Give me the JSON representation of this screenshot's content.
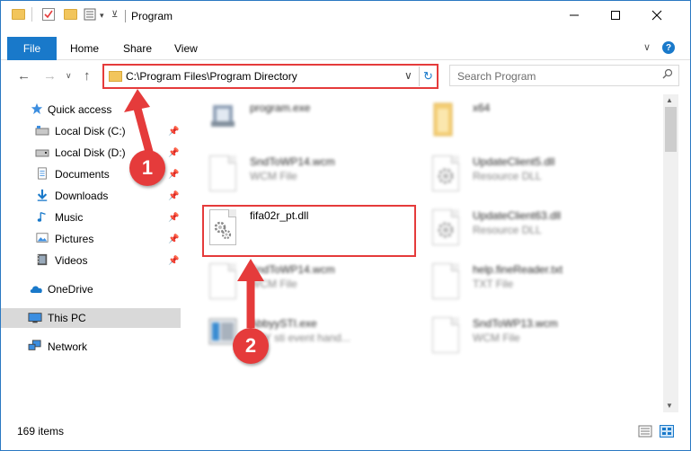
{
  "window": {
    "title": "Program",
    "minimize_icon": "minimize-icon",
    "maximize_icon": "maximize-icon",
    "close_icon": "close-icon"
  },
  "ribbon": {
    "tabs": [
      {
        "label": "File"
      },
      {
        "label": "Home"
      },
      {
        "label": "Share"
      },
      {
        "label": "View"
      }
    ],
    "help": "?"
  },
  "navigation": {
    "address": "C:\\Program Files\\Program Directory",
    "search_placeholder": "Search Program"
  },
  "sidebar": {
    "items": [
      {
        "label": "Quick access",
        "icon": "star-icon"
      },
      {
        "label": "Local Disk (C:)",
        "icon": "drive-icon",
        "pinned": true
      },
      {
        "label": "Local Disk (D:)",
        "icon": "drive-icon",
        "pinned": true
      },
      {
        "label": "Documents",
        "icon": "documents-icon",
        "pinned": true
      },
      {
        "label": "Downloads",
        "icon": "downloads-icon",
        "pinned": true
      },
      {
        "label": "Music",
        "icon": "music-icon",
        "pinned": true
      },
      {
        "label": "Pictures",
        "icon": "pictures-icon",
        "pinned": true
      },
      {
        "label": "Videos",
        "icon": "videos-icon",
        "pinned": true
      },
      {
        "label": "OneDrive",
        "icon": "onedrive-icon"
      },
      {
        "label": "This PC",
        "icon": "computer-icon",
        "selected": true
      },
      {
        "label": "Network",
        "icon": "network-icon"
      }
    ]
  },
  "files": [
    {
      "name": "program.exe",
      "type": "",
      "icon": "exe-icon"
    },
    {
      "name": "x64",
      "type": "",
      "icon": "folder-icon"
    },
    {
      "name": "SndToWP14.wcm",
      "type": "WCM File",
      "icon": "file-icon"
    },
    {
      "name": "UpdateClient5.dll",
      "type": "Resource DLL",
      "icon": "dll-icon"
    },
    {
      "name": "fifa02r_pt.dll",
      "type": "",
      "icon": "dll-icon"
    },
    {
      "name": "UpdateClient63.dll",
      "type": "Resource DLL",
      "icon": "dll-icon"
    },
    {
      "name": "SndToWP14.wcm",
      "type": "WCM File",
      "icon": "file-icon"
    },
    {
      "name": "help.fineReader.txt",
      "type": "TXT File",
      "icon": "file-icon"
    },
    {
      "name": "AbbyySTI.exe",
      "type": "BBY sti event hand...",
      "icon": "exe-icon"
    },
    {
      "name": "SndToWP13.wcm",
      "type": "WCM File",
      "icon": "file-icon"
    }
  ],
  "status": {
    "item_count": "169 items"
  },
  "callouts": [
    {
      "label": "1"
    },
    {
      "label": "2"
    }
  ],
  "colors": {
    "accent": "#1979ca",
    "highlight": "#e53b3b",
    "folder": "#f2c55c"
  }
}
